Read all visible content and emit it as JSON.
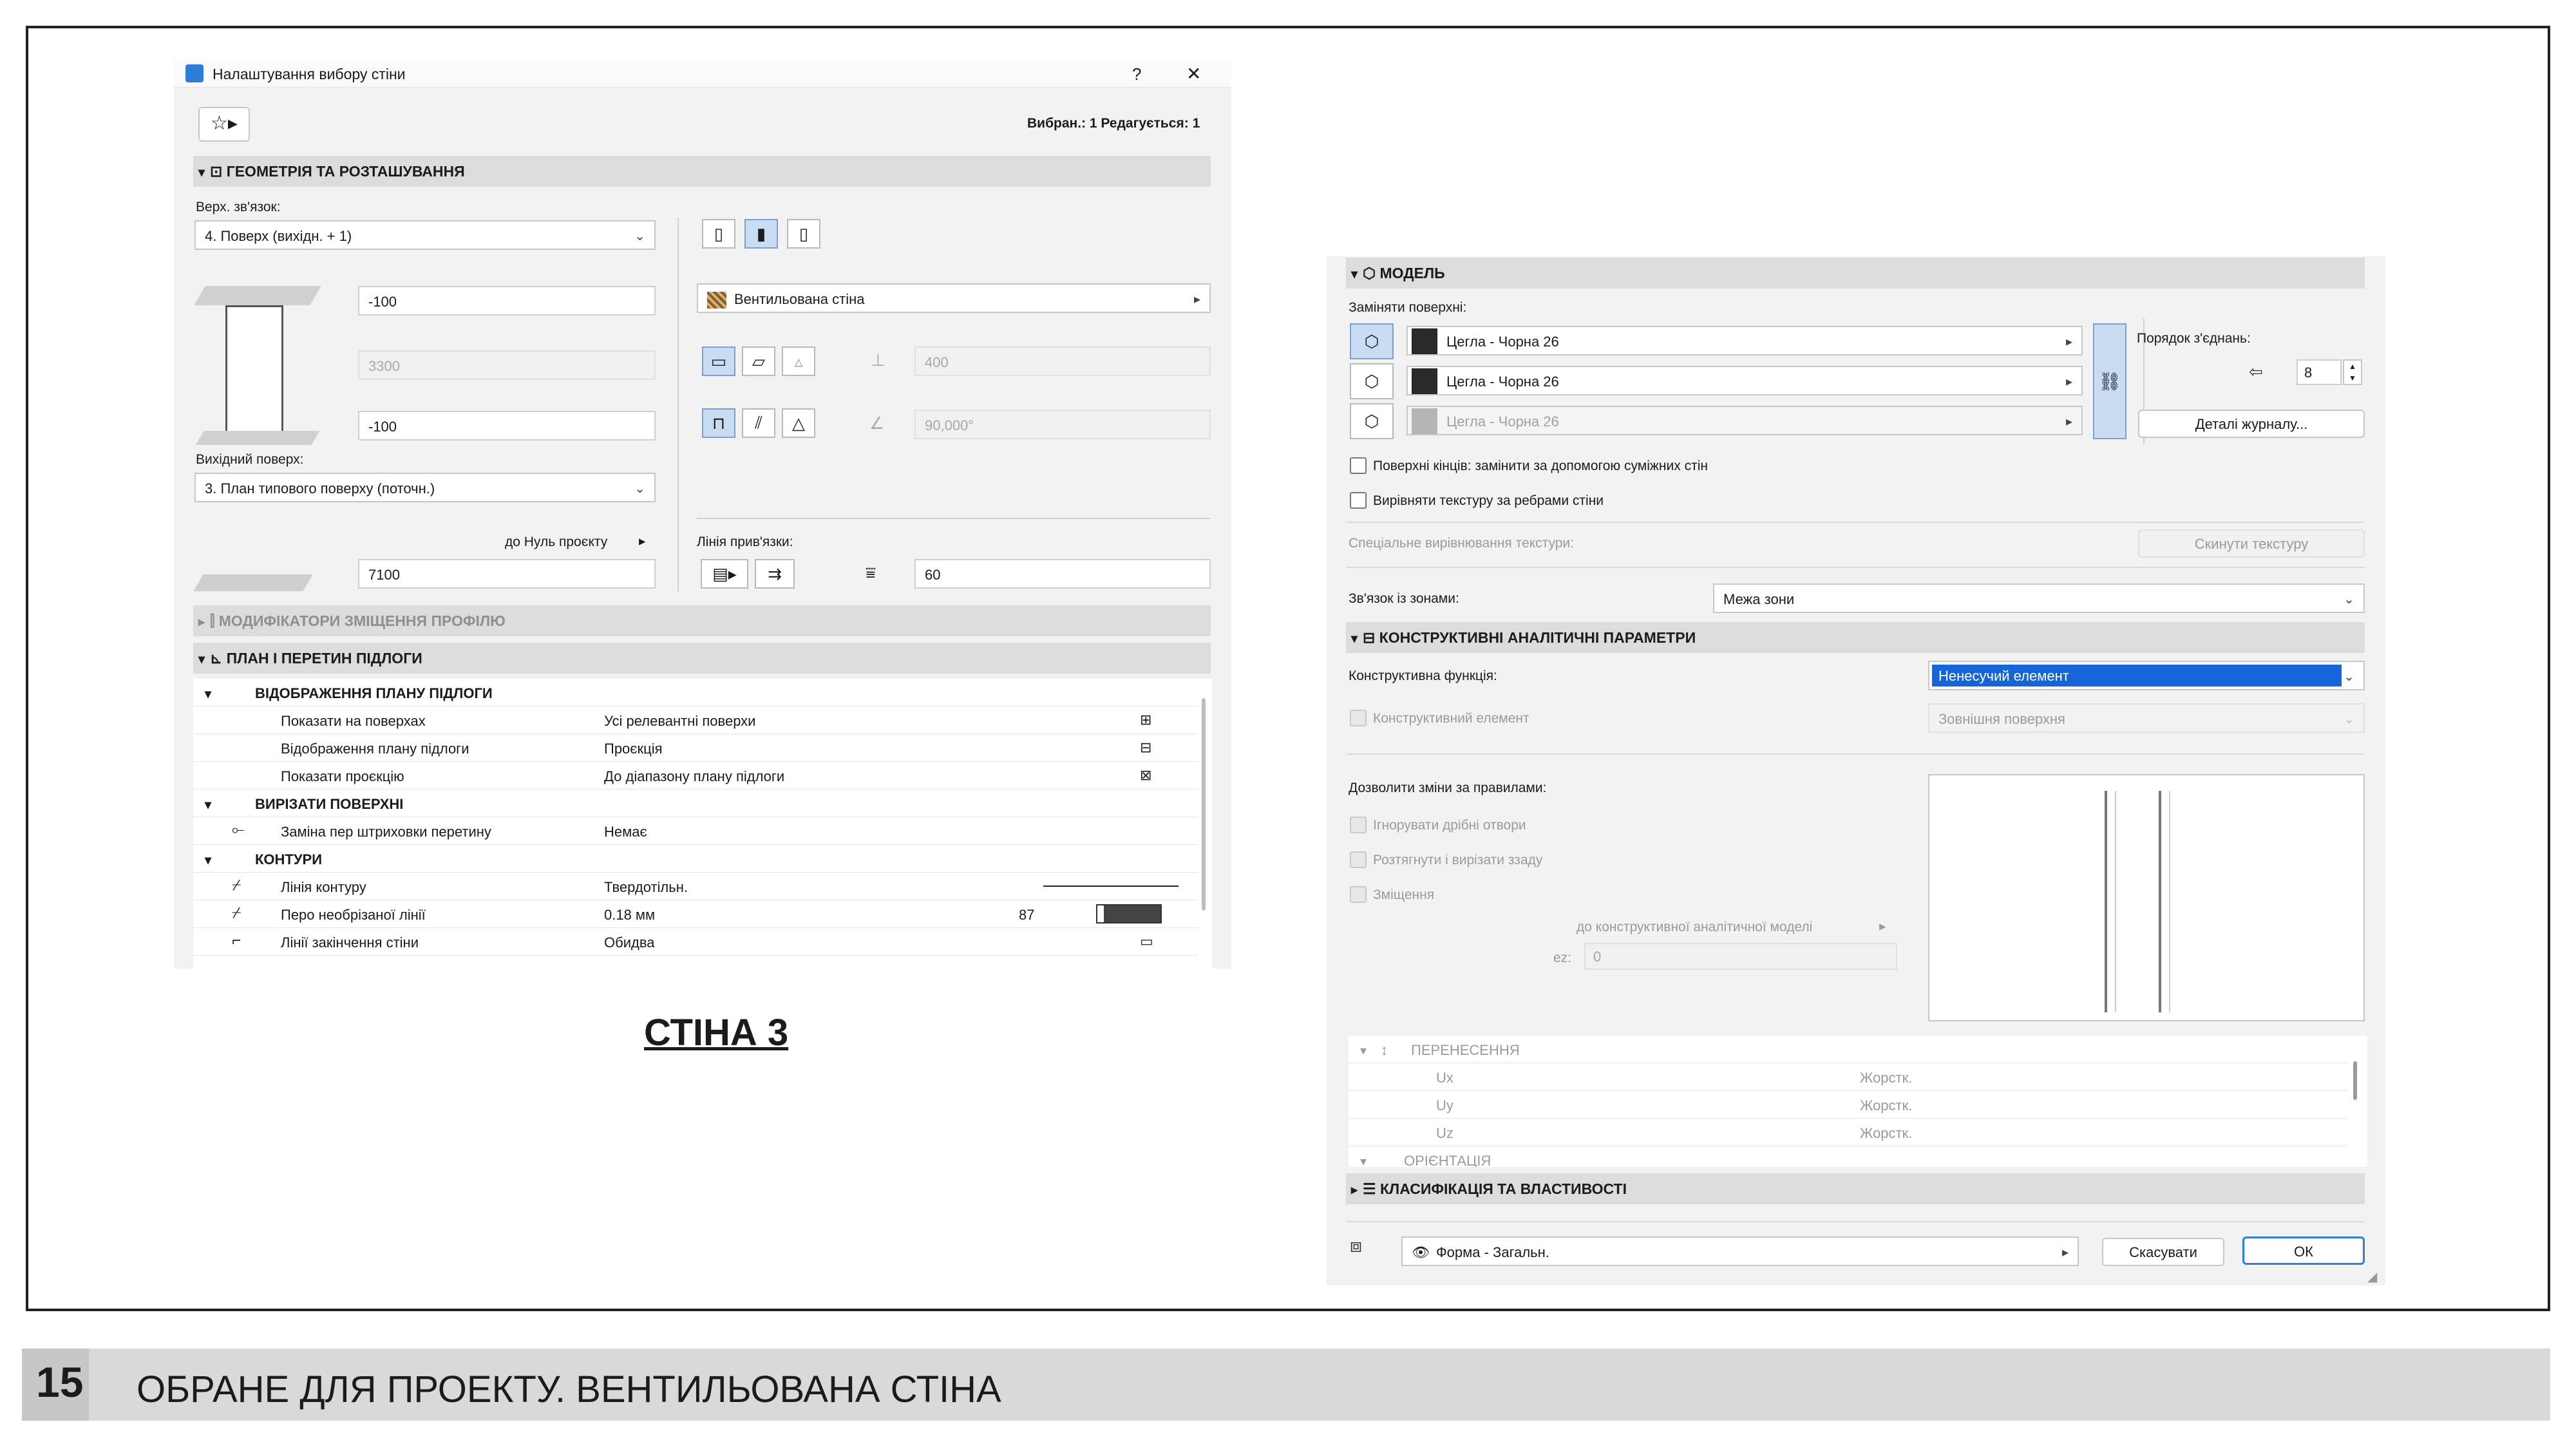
{
  "slide": {
    "page_number": "15",
    "footer_title": "ОБРАНЕ ДЛЯ ПРОЕКТУ. ВЕНТИЛЬОВАНА СТІНА",
    "caption": "СТІНА 3"
  },
  "left_dialog": {
    "title": "Налаштування вибору стіни",
    "help": "?",
    "close": "✕",
    "selection_info": "Вибран.: 1 Редагується: 1",
    "geometry": {
      "header": "ГЕОМЕТРІЯ ТА РОЗТАШУВАННЯ",
      "top_link_label": "Верх. зв'язок:",
      "top_link_value": "4. Поверх (вихідн. + 1)",
      "top_offset": "-100",
      "height": "3300",
      "bottom_offset": "-100",
      "home_story_label": "Вихідний поверх:",
      "home_story_value": "3. План типового поверху (поточн.)",
      "to_project_zero": "до Нуль проєкту",
      "zero_value": "7100",
      "structure_value": "Вентильована стіна",
      "thickness": "400",
      "angle": "90,000°",
      "ref_line_label": "Лінія прив'язки:",
      "ref_offset": "60"
    },
    "profile_header": "МОДИФІКАТОРИ ЗМІЩЕННЯ ПРОФІЛЮ",
    "plan_header": "ПЛАН І ПЕРЕТИН ПІДЛОГИ",
    "groups": [
      {
        "label": "ВІДОБРАЖЕННЯ ПЛАНУ ПІДЛОГИ"
      },
      {
        "label": "ВИРІЗАТИ ПОВЕРХНІ"
      },
      {
        "label": "КОНТУРИ"
      }
    ],
    "rows": [
      {
        "name": "Показати на поверхах",
        "value": "Усі релевантні поверхи"
      },
      {
        "name": "Відображення плану підлоги",
        "value": "Проєкція"
      },
      {
        "name": "Показати проєкцію",
        "value": "До діапазону плану підлоги"
      },
      {
        "name": "Заміна пер штриховки перетину",
        "value": "Немає"
      },
      {
        "name": "Лінія контуру",
        "value": "Твердотільн."
      },
      {
        "name": "Перо необрізаної лінії",
        "value": "0.18 мм",
        "extra": "87"
      },
      {
        "name": "Лінії закінчення стіни",
        "value": "Обидва"
      }
    ]
  },
  "right_dialog": {
    "model_header": "МОДЕЛЬ",
    "override_label": "Заміняти поверхні:",
    "surfaces": [
      {
        "value": "Цегла - Чорна 26",
        "color": "#2a2a2a"
      },
      {
        "value": "Цегла - Чорна 26",
        "color": "#2a2a2a"
      },
      {
        "value": "Цегла - Чорна 26",
        "color": "#b5b5b5"
      }
    ],
    "join_order_label": "Порядок з'єднань:",
    "join_order_value": "8",
    "log_details_button": "Деталі журналу...",
    "check_end_surfaces": "Поверхні кінців: замінити за допомогою суміжних стін",
    "check_align_texture": "Вирівняти текстуру за ребрами стіни",
    "special_alignment_label": "Спеціальне вирівнювання текстури:",
    "reset_texture_button": "Скинути текстуру",
    "zone_relation_label": "Зв'язок із зонами:",
    "zone_relation_value": "Межа зони",
    "structural_header": "КОНСТРУКТИВНІ АНАЛІТИЧНІ ПАРАМЕТРИ",
    "structural_function_label": "Конструктивна функція:",
    "structural_function_value": "Ненесучий елемент",
    "structural_element_label": "Конструктивний елемент",
    "structural_element_value": "Зовнішня поверхня",
    "allow_changes_label": "Дозволити зміни за правилами:",
    "rule_checks": [
      "Ігнорувати дрібні отвори",
      "Розтягнути і вирізати ззаду",
      "Зміщення"
    ],
    "to_model_label": "до конструктивної аналітичної моделі",
    "ez_label": "ez:",
    "ez_value": "0",
    "transfer_header": "ПЕРЕНЕСЕННЯ",
    "transfer_rows": [
      {
        "name": "Ux",
        "value": "Жорстк."
      },
      {
        "name": "Uy",
        "value": "Жорстк."
      },
      {
        "name": "Uz",
        "value": "Жорстк."
      }
    ],
    "orientation_header": "ОРІЄНТАЦІЯ",
    "classification_header": "КЛАСИФІКАЦІЯ ТА ВЛАСТИВОСТІ",
    "form_value": "Форма - Загальн.",
    "cancel_button": "Скасувати",
    "ok_button": "ОК"
  },
  "colors": {
    "accent_blue": "#1565d8",
    "header_grey": "#dcdcdc",
    "footer_grey": "#d9d9d9"
  }
}
